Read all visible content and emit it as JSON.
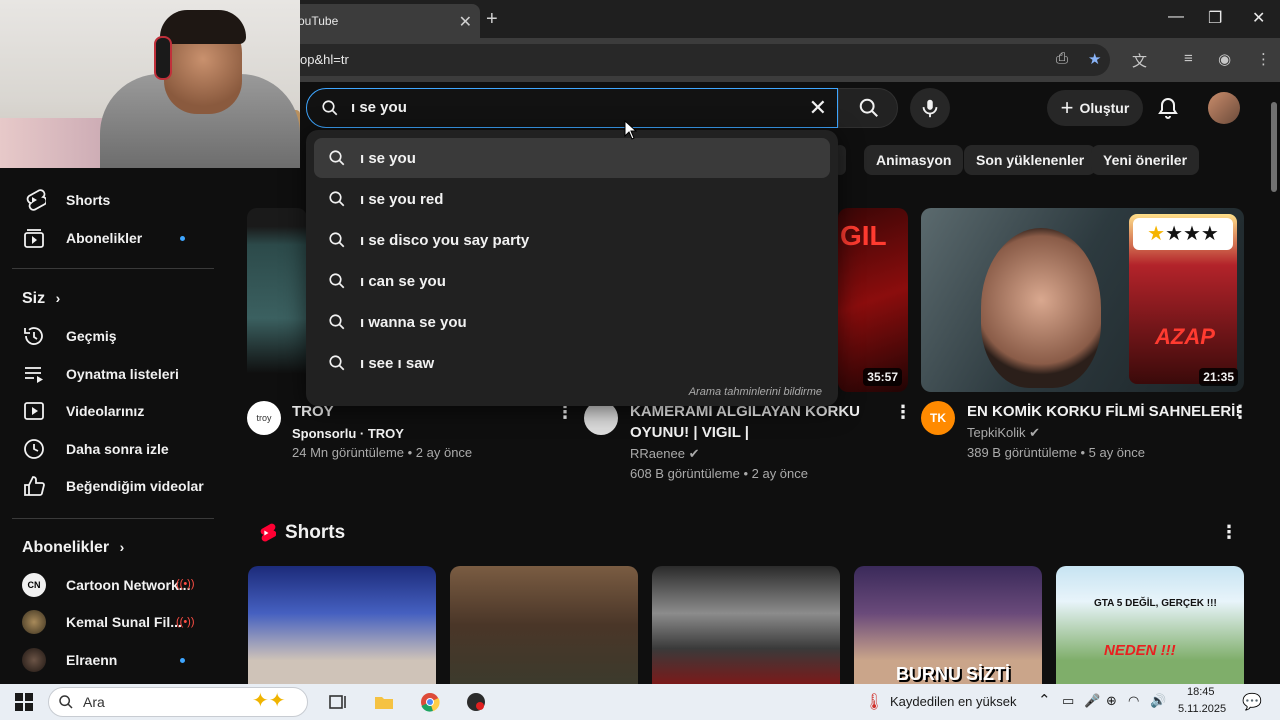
{
  "browser": {
    "tab_title": "ouTube",
    "url_fragment": "op&hl=tr"
  },
  "header": {
    "search_query": "ı se you",
    "create_label": "Oluştur"
  },
  "chips": [
    "Animasyon",
    "Son yüklenenler",
    "Yeni öneriler"
  ],
  "suggestions": {
    "items": [
      "ı se you",
      "ı se you red",
      "ı se disco you say party",
      "ı can se you",
      "ı wanna se you",
      "ı see ı saw"
    ],
    "report_label": "Arama tahminlerini bildirme"
  },
  "sidebar": {
    "top_items": [
      {
        "label": "Shorts",
        "icon": "shorts-icon"
      },
      {
        "label": "Abonelikler",
        "icon": "subscriptions-icon"
      }
    ],
    "you_header": "Siz",
    "you_items": [
      {
        "label": "Geçmiş",
        "icon": "history-icon"
      },
      {
        "label": "Oynatma listeleri",
        "icon": "playlists-icon"
      },
      {
        "label": "Videolarınız",
        "icon": "your-videos-icon"
      },
      {
        "label": "Daha sonra izle",
        "icon": "watch-later-icon"
      },
      {
        "label": "Beğendiğim videolar",
        "icon": "liked-icon"
      }
    ],
    "subs_header": "Abonelikler",
    "subs_items": [
      {
        "label": "Cartoon Network..."
      },
      {
        "label": "Kemal Sunal Fil..."
      },
      {
        "label": "Elraenn"
      }
    ]
  },
  "videos": [
    {
      "title": "TROY",
      "channel_line": "Sponsorlu · TROY",
      "meta": "24 Mn görüntüleme • 2 ay önce",
      "avatar_text": "troy"
    },
    {
      "title_line1": "KAMERAMI ALGILAYAN KORKU",
      "title_line2": "OYUNU! | VIGIL |",
      "channel": "RRaenee",
      "meta": "608 B görüntüleme • 2 ay önce",
      "duration": "35:57",
      "thumb_text": "GIL"
    },
    {
      "title": "EN KOMİK KORKU FİLMİ SAHNELERİ!",
      "channel": "TepkiKolik",
      "meta": "389 B görüntüleme • 5 ay önce",
      "duration": "21:35",
      "avatar_text": "TK",
      "thumb_text": "AZAP"
    }
  ],
  "shorts": {
    "title": "Shorts",
    "items": [
      {
        "overlay": ""
      },
      {
        "overlay": ""
      },
      {
        "overlay": ""
      },
      {
        "overlay": "BURNU SİZTİ"
      },
      {
        "overlay": "GTA 5 DEĞİL, GERÇEK !!!",
        "overlay2": "NEDEN !!!"
      }
    ]
  },
  "taskbar": {
    "search_placeholder": "Ara",
    "weather_text": "Kaydedilen en yüksek",
    "time": "18:45",
    "date": "5.11.2025"
  },
  "colors": {
    "accent": "#3ea6ff",
    "background": "#0f0f0f",
    "live": "#ff4e45",
    "shorts_red": "#ff0033"
  }
}
